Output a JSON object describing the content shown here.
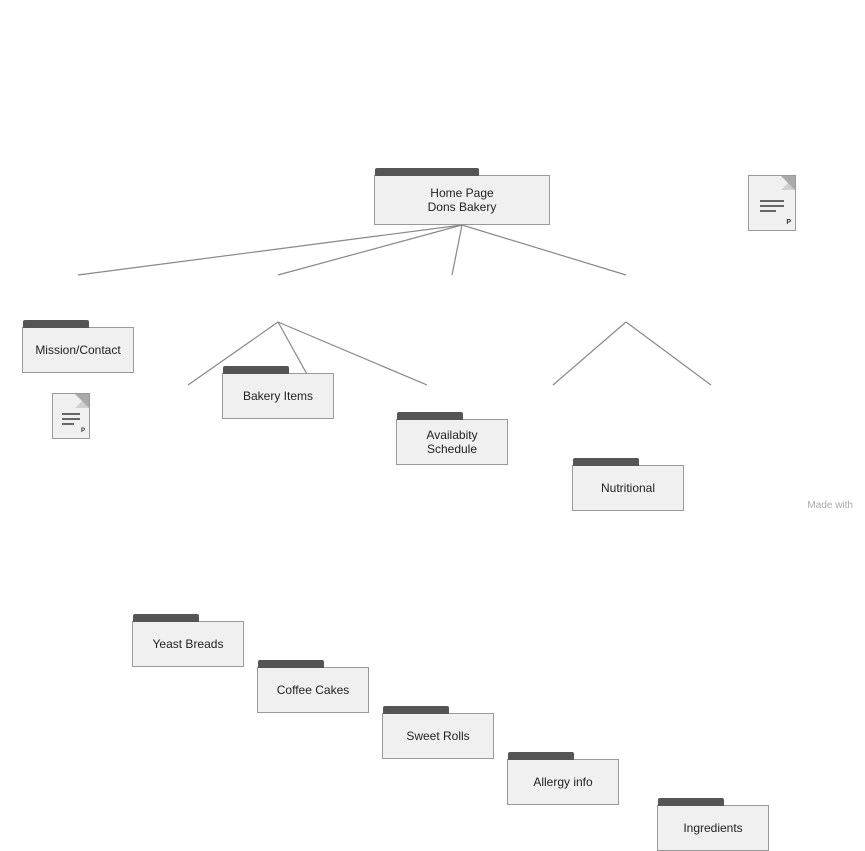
{
  "nodes": {
    "home": {
      "label_line1": "Home Page",
      "label_line2": "Dons Bakery"
    },
    "mission": {
      "label": "Mission/Contact"
    },
    "bakery_items": {
      "label": "Bakery Items"
    },
    "availability": {
      "label_line1": "Availabity",
      "label_line2": "Schedule"
    },
    "nutritional": {
      "label": "Nutritional"
    },
    "yeast_breads": {
      "label": "Yeast Breads"
    },
    "coffee_cakes": {
      "label": "Coffee Cakes"
    },
    "sweet_rolls": {
      "label": "Sweet Rolls"
    },
    "allergy_info": {
      "label": "Allergy info"
    },
    "ingredients": {
      "label": "Ingredients"
    }
  },
  "footer": {
    "made_with": "Made with"
  }
}
